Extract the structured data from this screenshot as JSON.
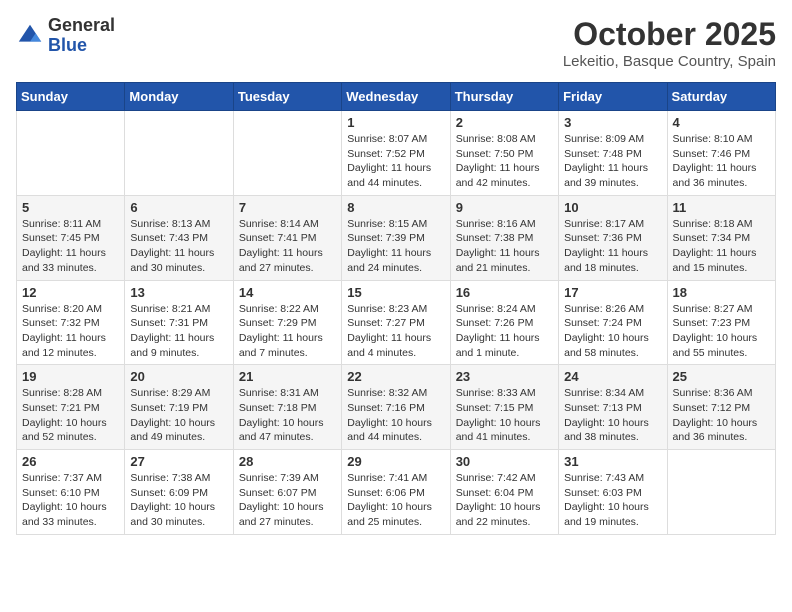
{
  "logo": {
    "general": "General",
    "blue": "Blue"
  },
  "title": "October 2025",
  "location": "Lekeitio, Basque Country, Spain",
  "weekdays": [
    "Sunday",
    "Monday",
    "Tuesday",
    "Wednesday",
    "Thursday",
    "Friday",
    "Saturday"
  ],
  "weeks": [
    [
      {
        "day": "",
        "info": ""
      },
      {
        "day": "",
        "info": ""
      },
      {
        "day": "",
        "info": ""
      },
      {
        "day": "1",
        "info": "Sunrise: 8:07 AM\nSunset: 7:52 PM\nDaylight: 11 hours and 44 minutes."
      },
      {
        "day": "2",
        "info": "Sunrise: 8:08 AM\nSunset: 7:50 PM\nDaylight: 11 hours and 42 minutes."
      },
      {
        "day": "3",
        "info": "Sunrise: 8:09 AM\nSunset: 7:48 PM\nDaylight: 11 hours and 39 minutes."
      },
      {
        "day": "4",
        "info": "Sunrise: 8:10 AM\nSunset: 7:46 PM\nDaylight: 11 hours and 36 minutes."
      }
    ],
    [
      {
        "day": "5",
        "info": "Sunrise: 8:11 AM\nSunset: 7:45 PM\nDaylight: 11 hours and 33 minutes."
      },
      {
        "day": "6",
        "info": "Sunrise: 8:13 AM\nSunset: 7:43 PM\nDaylight: 11 hours and 30 minutes."
      },
      {
        "day": "7",
        "info": "Sunrise: 8:14 AM\nSunset: 7:41 PM\nDaylight: 11 hours and 27 minutes."
      },
      {
        "day": "8",
        "info": "Sunrise: 8:15 AM\nSunset: 7:39 PM\nDaylight: 11 hours and 24 minutes."
      },
      {
        "day": "9",
        "info": "Sunrise: 8:16 AM\nSunset: 7:38 PM\nDaylight: 11 hours and 21 minutes."
      },
      {
        "day": "10",
        "info": "Sunrise: 8:17 AM\nSunset: 7:36 PM\nDaylight: 11 hours and 18 minutes."
      },
      {
        "day": "11",
        "info": "Sunrise: 8:18 AM\nSunset: 7:34 PM\nDaylight: 11 hours and 15 minutes."
      }
    ],
    [
      {
        "day": "12",
        "info": "Sunrise: 8:20 AM\nSunset: 7:32 PM\nDaylight: 11 hours and 12 minutes."
      },
      {
        "day": "13",
        "info": "Sunrise: 8:21 AM\nSunset: 7:31 PM\nDaylight: 11 hours and 9 minutes."
      },
      {
        "day": "14",
        "info": "Sunrise: 8:22 AM\nSunset: 7:29 PM\nDaylight: 11 hours and 7 minutes."
      },
      {
        "day": "15",
        "info": "Sunrise: 8:23 AM\nSunset: 7:27 PM\nDaylight: 11 hours and 4 minutes."
      },
      {
        "day": "16",
        "info": "Sunrise: 8:24 AM\nSunset: 7:26 PM\nDaylight: 11 hours and 1 minute."
      },
      {
        "day": "17",
        "info": "Sunrise: 8:26 AM\nSunset: 7:24 PM\nDaylight: 10 hours and 58 minutes."
      },
      {
        "day": "18",
        "info": "Sunrise: 8:27 AM\nSunset: 7:23 PM\nDaylight: 10 hours and 55 minutes."
      }
    ],
    [
      {
        "day": "19",
        "info": "Sunrise: 8:28 AM\nSunset: 7:21 PM\nDaylight: 10 hours and 52 minutes."
      },
      {
        "day": "20",
        "info": "Sunrise: 8:29 AM\nSunset: 7:19 PM\nDaylight: 10 hours and 49 minutes."
      },
      {
        "day": "21",
        "info": "Sunrise: 8:31 AM\nSunset: 7:18 PM\nDaylight: 10 hours and 47 minutes."
      },
      {
        "day": "22",
        "info": "Sunrise: 8:32 AM\nSunset: 7:16 PM\nDaylight: 10 hours and 44 minutes."
      },
      {
        "day": "23",
        "info": "Sunrise: 8:33 AM\nSunset: 7:15 PM\nDaylight: 10 hours and 41 minutes."
      },
      {
        "day": "24",
        "info": "Sunrise: 8:34 AM\nSunset: 7:13 PM\nDaylight: 10 hours and 38 minutes."
      },
      {
        "day": "25",
        "info": "Sunrise: 8:36 AM\nSunset: 7:12 PM\nDaylight: 10 hours and 36 minutes."
      }
    ],
    [
      {
        "day": "26",
        "info": "Sunrise: 7:37 AM\nSunset: 6:10 PM\nDaylight: 10 hours and 33 minutes."
      },
      {
        "day": "27",
        "info": "Sunrise: 7:38 AM\nSunset: 6:09 PM\nDaylight: 10 hours and 30 minutes."
      },
      {
        "day": "28",
        "info": "Sunrise: 7:39 AM\nSunset: 6:07 PM\nDaylight: 10 hours and 27 minutes."
      },
      {
        "day": "29",
        "info": "Sunrise: 7:41 AM\nSunset: 6:06 PM\nDaylight: 10 hours and 25 minutes."
      },
      {
        "day": "30",
        "info": "Sunrise: 7:42 AM\nSunset: 6:04 PM\nDaylight: 10 hours and 22 minutes."
      },
      {
        "day": "31",
        "info": "Sunrise: 7:43 AM\nSunset: 6:03 PM\nDaylight: 10 hours and 19 minutes."
      },
      {
        "day": "",
        "info": ""
      }
    ]
  ]
}
